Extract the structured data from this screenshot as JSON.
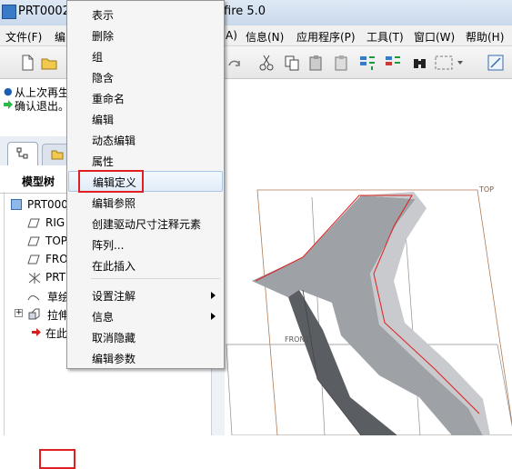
{
  "window": {
    "title_left": "PRT0002",
    "title_right": "fire 5.0"
  },
  "menubar": {
    "items": [
      "文件(F)",
      "编",
      "A)",
      "信息(N)",
      "应用程序(P)",
      "工具(T)",
      "窗口(W)",
      "帮助(H)"
    ]
  },
  "messages": {
    "line1": "从上次再生",
    "line2": "确认退出。"
  },
  "model_tree": {
    "header": "模型树",
    "items": [
      "PRT000",
      "RIG",
      "TOP",
      "FRO",
      "PRT",
      "草绘",
      "拉伸",
      "在此"
    ]
  },
  "viewport": {
    "label_top": "TOP",
    "label_front": "FRONT"
  },
  "context_menu": {
    "items": [
      "表示",
      "删除",
      "组",
      "隐含",
      "重命名",
      "编辑",
      "动态编辑",
      "属性",
      "编辑定义",
      "编辑参照",
      "创建驱动尺寸注释元素",
      "阵列...",
      "在此插入",
      "设置注解",
      "信息",
      "取消隐藏",
      "编辑参数"
    ],
    "highlighted": "编辑定义"
  },
  "colors": {
    "highlight_border": "#e02020",
    "title_bg": "#d3e1f1",
    "model_gray": "#8a8d92"
  }
}
